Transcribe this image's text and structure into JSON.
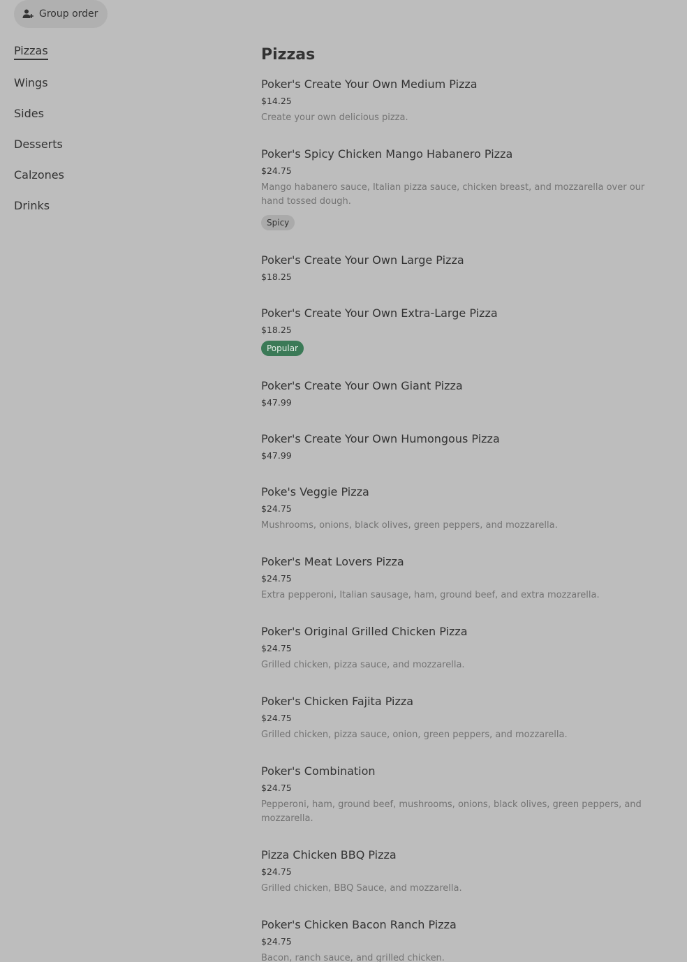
{
  "header": {
    "group_order_label": "Group order",
    "group_order_icon": "person-add-icon"
  },
  "sidebar": {
    "items": [
      {
        "label": "Pizzas",
        "active": true
      },
      {
        "label": "Wings"
      },
      {
        "label": "Sides"
      },
      {
        "label": "Desserts"
      },
      {
        "label": "Calzones"
      },
      {
        "label": "Drinks"
      }
    ]
  },
  "menu": {
    "section_title": "Pizzas",
    "items": [
      {
        "name": "Poker's Create Your Own Medium Pizza",
        "price": "$14.25",
        "description": "Create your own delicious pizza."
      },
      {
        "name": "Poker's Spicy Chicken Mango Habanero Pizza",
        "price": "$24.75",
        "description": "Mango habanero sauce, Italian pizza sauce, chicken breast, and mozzarella over our hand tossed dough.",
        "badge": "Spicy"
      },
      {
        "name": "Poker's Create Your Own Large Pizza",
        "price": "$18.25"
      },
      {
        "name": "Poker's Create Your Own Extra-Large Pizza",
        "price": "$18.25",
        "badge": "Popular"
      },
      {
        "name": "Poker's Create Your Own Giant Pizza",
        "price": "$47.99"
      },
      {
        "name": "Poker's Create Your Own Humongous Pizza",
        "price": "$47.99"
      },
      {
        "name": "Poke's Veggie Pizza",
        "price": "$24.75",
        "description": "Mushrooms, onions, black olives, green peppers, and mozzarella."
      },
      {
        "name": "Poker's Meat Lovers Pizza",
        "price": "$24.75",
        "description": "Extra pepperoni, Italian sausage, ham, ground beef, and extra mozzarella."
      },
      {
        "name": "Poker's Original Grilled Chicken Pizza",
        "price": "$24.75",
        "description": "Grilled chicken, pizza sauce, and mozzarella."
      },
      {
        "name": "Poker's Chicken Fajita Pizza",
        "price": "$24.75",
        "description": "Grilled chicken, pizza sauce, onion, green peppers, and mozzarella."
      },
      {
        "name": "Poker's Combination",
        "price": "$24.75",
        "description": "Pepperoni, ham, ground beef, mushrooms, onions, black olives, green peppers, and mozzarella."
      },
      {
        "name": "Pizza Chicken BBQ Pizza",
        "price": "$24.75",
        "description": "Grilled chicken, BBQ Sauce, and mozzarella."
      },
      {
        "name": "Poker's Chicken Bacon Ranch Pizza",
        "price": "$24.75",
        "description": "Bacon, ranch sauce, and grilled chicken."
      }
    ]
  },
  "colors": {
    "background": "#bdbdbd",
    "popular_badge": "#3b7a57",
    "spicy_badge": "#aaaaaa",
    "description_text": "#737373"
  }
}
